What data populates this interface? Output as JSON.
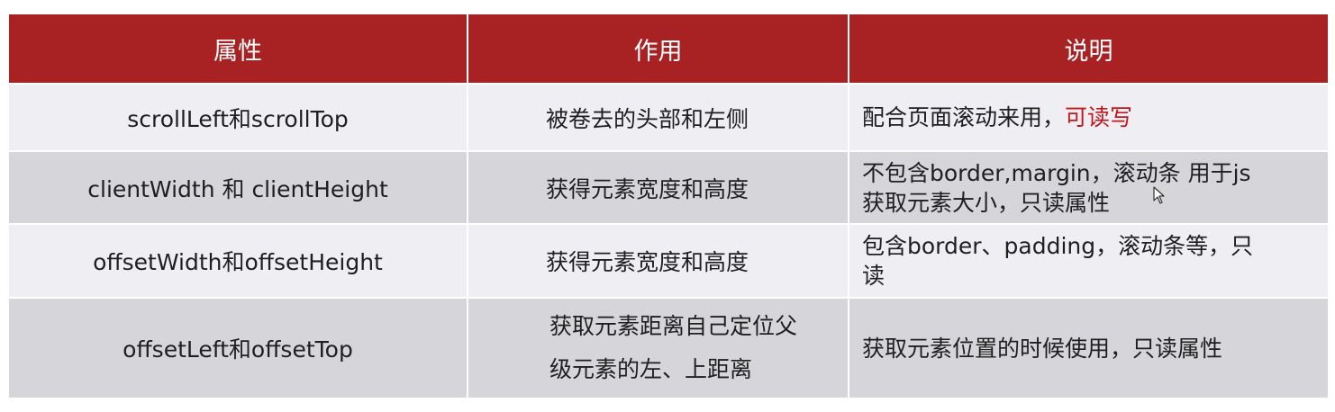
{
  "table": {
    "headers": [
      "属性",
      "作用",
      "说明"
    ],
    "rows": [
      {
        "property": "scrollLeft和scrollTop",
        "purpose": "被卷去的头部和左侧",
        "desc_normal": "配合页面滚动来用，",
        "desc_red": "可读写"
      },
      {
        "property": "clientWidth 和 clientHeight",
        "purpose": "获得元素宽度和高度",
        "desc_line1": "不包含border,margin，滚动条 用于js",
        "desc_line2": "获取元素大小，只读属性"
      },
      {
        "property": "offsetWidth和offsetHeight",
        "purpose": "获得元素宽度和高度",
        "desc_red_line1": "包含border、padding，滚动条等，只",
        "desc_red_line2": "读"
      },
      {
        "property": "offsetLeft和offsetTop",
        "purpose_line1": "获取元素距离自己定位父",
        "purpose_line2": "级元素的左、上距离",
        "desc": "获取元素位置的时候使用，只读属性"
      }
    ]
  },
  "colors": {
    "header_bg": "#a82224",
    "row_light": "#efeff3",
    "row_dark": "#d6d6da",
    "highlight": "#c0171c"
  },
  "icons": {
    "cursor": "mouse-pointer-icon"
  }
}
